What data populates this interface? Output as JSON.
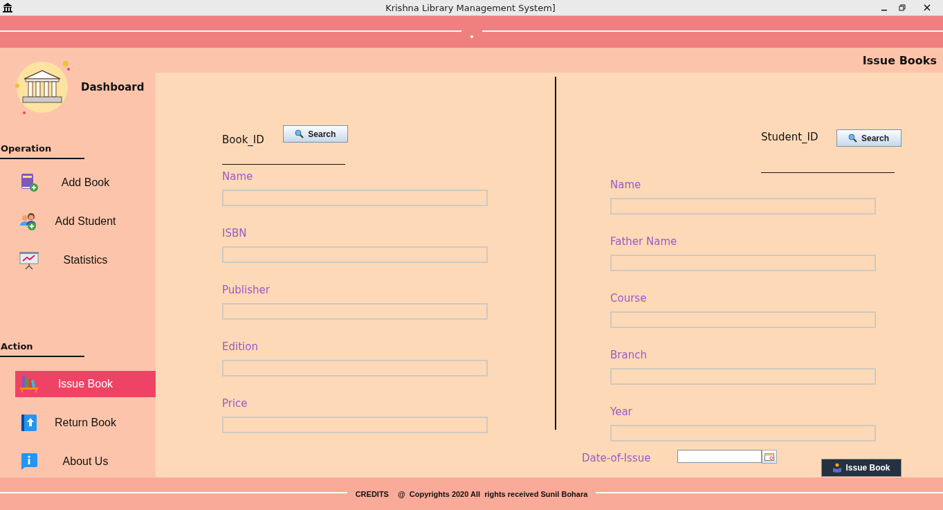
{
  "window": {
    "title": "Krishna Library Management System]"
  },
  "header": {
    "title": "Issue Books"
  },
  "sidebar": {
    "brand": "Dashboard",
    "sections": [
      {
        "heading": "Operation",
        "items": [
          {
            "label": "Add Book",
            "kind": "book-add",
            "selected": false
          },
          {
            "label": "Add Student",
            "kind": "student-add",
            "selected": false
          },
          {
            "label": "Statistics",
            "kind": "chart",
            "selected": false
          }
        ]
      },
      {
        "heading": "Action",
        "items": [
          {
            "label": "Issue Book",
            "kind": "bookshelf",
            "selected": true
          },
          {
            "label": "Return Book",
            "kind": "return",
            "selected": false
          },
          {
            "label": "About Us",
            "kind": "info",
            "selected": false
          }
        ]
      }
    ]
  },
  "book": {
    "id_label": "Book_ID",
    "search_button": "Search",
    "fields": [
      "Name",
      "ISBN",
      "Publisher",
      "Edition",
      "Price"
    ]
  },
  "student": {
    "id_label": "Student_ID",
    "search_button": "Search",
    "fields": [
      "Name",
      "Father Name",
      "Course",
      "Branch",
      "Year"
    ]
  },
  "date_of_issue": {
    "label": "Date-of-Issue"
  },
  "issue_button": "Issue Book",
  "footer": {
    "credits": "CREDITS",
    "copyright": "@  Copyrights 2020 All  rights received Sunil Bohara"
  }
}
